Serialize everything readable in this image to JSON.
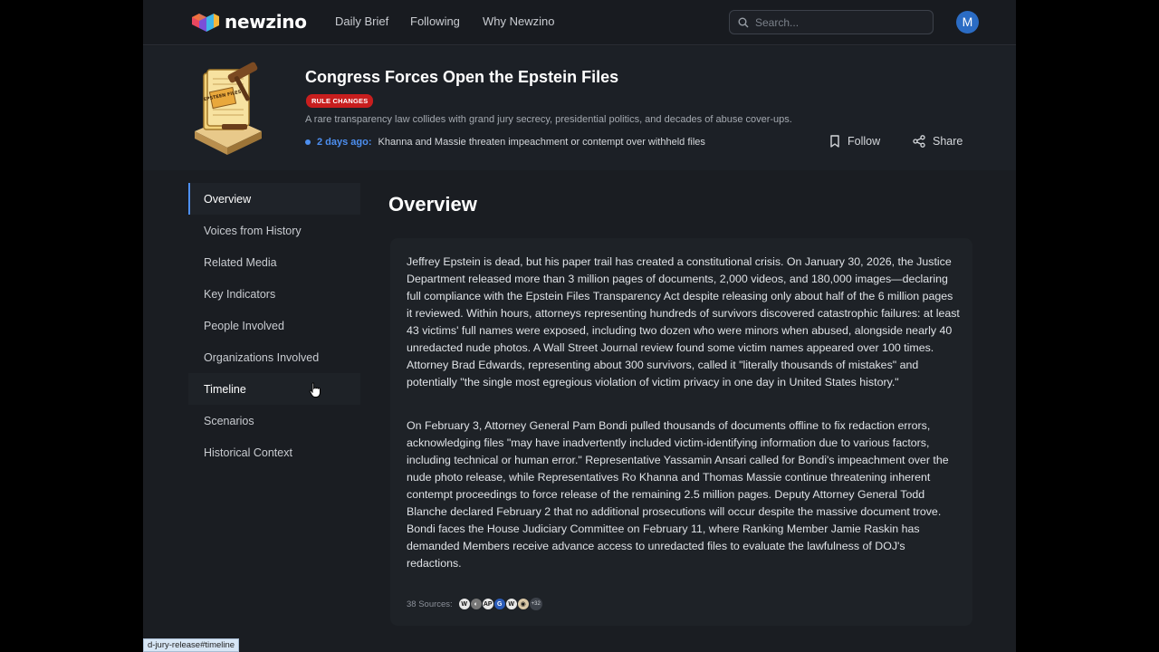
{
  "nav": {
    "brand": "newzino",
    "links": [
      "Daily Brief",
      "Following",
      "Why Newzino"
    ],
    "search_placeholder": "Search...",
    "avatar_initial": "M"
  },
  "story": {
    "image_label": "EPSTEEN FILES",
    "title": "Congress Forces Open the Epstein Files",
    "badge": "RULE CHANGES",
    "subtitle": "A rare transparency law collides with grand jury secrecy, presidential politics, and decades of abuse cover-ups.",
    "update_when": "2 days ago:",
    "update_text": "Khanna and Massie threaten impeachment or contempt over withheld files",
    "follow_label": "Follow",
    "share_label": "Share"
  },
  "sidebar": {
    "items": [
      {
        "label": "Overview"
      },
      {
        "label": "Voices from History"
      },
      {
        "label": "Related Media"
      },
      {
        "label": "Key Indicators"
      },
      {
        "label": "People Involved"
      },
      {
        "label": "Organizations Involved"
      },
      {
        "label": "Timeline"
      },
      {
        "label": "Scenarios"
      },
      {
        "label": "Historical Context"
      }
    ]
  },
  "main": {
    "title": "Overview",
    "paragraphs": [
      "Jeffrey Epstein is dead, but his paper trail has created a constitutional crisis. On January 30, 2026, the Justice Department released more than 3 million pages of documents, 2,000 videos, and 180,000 images—declaring full compliance with the Epstein Files Transparency Act despite releasing only about half of the 6 million pages it reviewed. Within hours, attorneys representing hundreds of survivors discovered catastrophic failures: at least 43 victims' full names were exposed, including two dozen who were minors when abused, alongside nearly 40 unredacted nude photos. A Wall Street Journal review found some victim names appeared over 100 times. Attorney Brad Edwards, representing about 300 survivors, called it \"literally thousands of mistakes\" and potentially \"the single most egregious violation of victim privacy in one day in United States history.\"",
      "On February 3, Attorney General Pam Bondi pulled thousands of documents offline to fix redaction errors, acknowledging files \"may have inadvertently included victim-identifying information due to various factors, including technical or human error.\" Representative Yassamin Ansari called for Bondi's impeachment over the nude photo release, while Representatives Ro Khanna and Thomas Massie continue threatening inherent contempt proceedings to force release of the remaining 2.5 million pages. Deputy Attorney General Todd Blanche declared February 2 that no additional prosecutions will occur despite the massive document trove. Bondi faces the House Judiciary Committee on February 11, where Ranking Member Jamie Raskin has demanded Members receive advance access to unredacted files to evaluate the lawfulness of DOJ's redactions."
    ],
    "sources_label": "38 Sources:",
    "source_icons": [
      "W",
      "◐",
      "AP",
      "G",
      "W",
      "◉"
    ],
    "sources_more": "+32"
  },
  "status_url": "d-jury-release#timeline",
  "colors": {
    "accent": "#4d8ff0",
    "badge": "#c81e1e",
    "background": "#1a1d22"
  }
}
